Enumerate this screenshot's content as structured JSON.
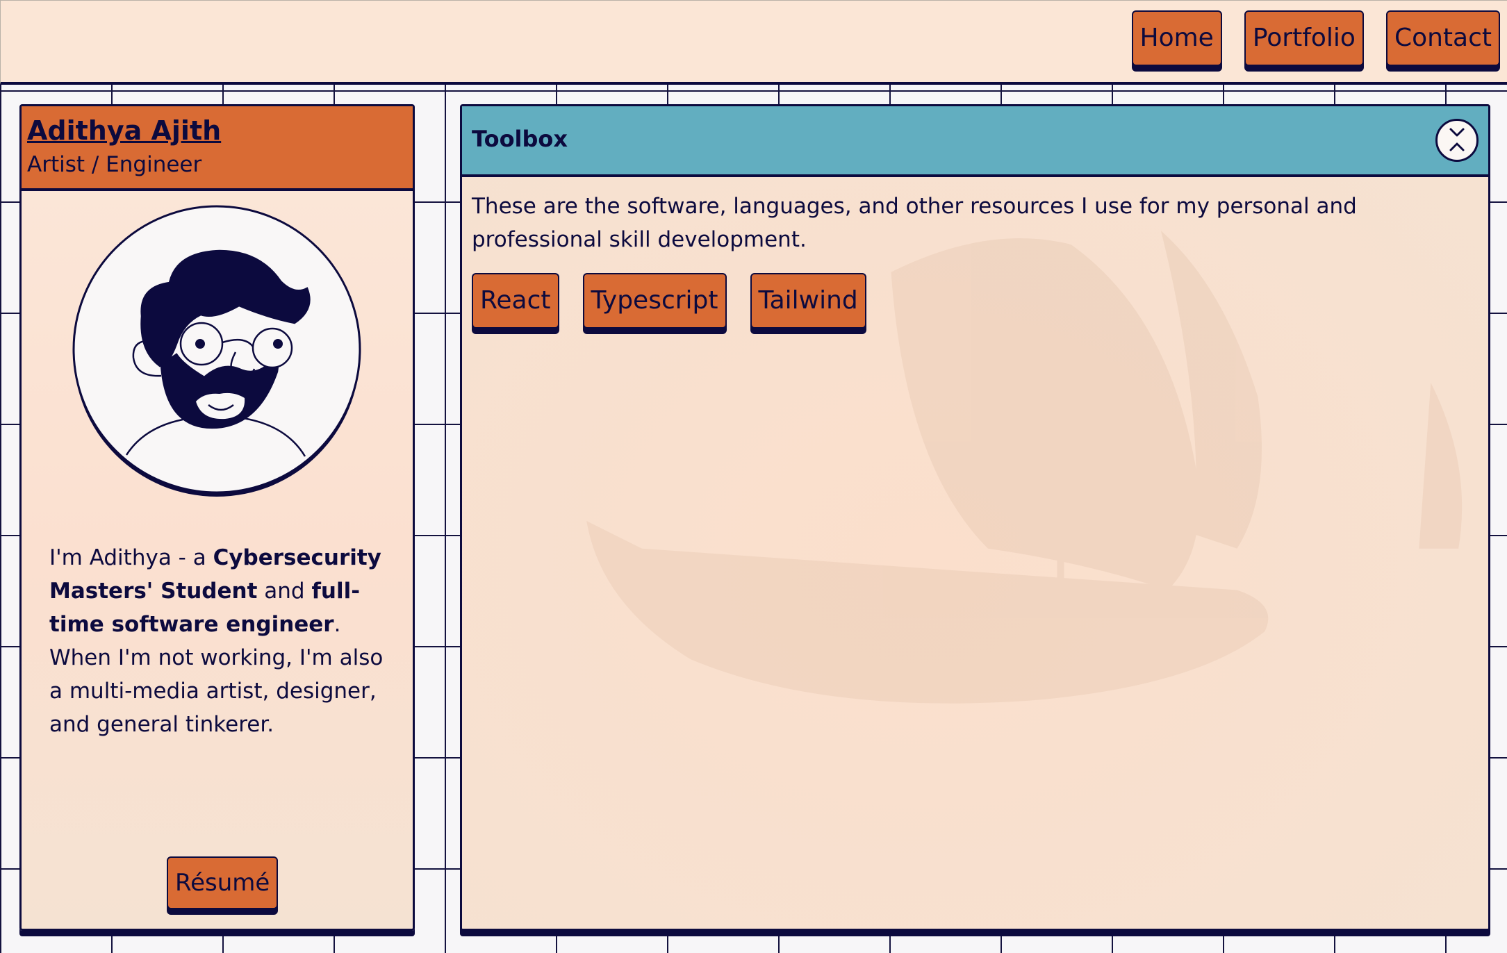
{
  "nav": {
    "items": [
      "Home",
      "Portfolio",
      "Contact"
    ]
  },
  "profile": {
    "name": "Adithya Ajith",
    "role": "Artist / Engineer",
    "bio": {
      "p1": "I'm Adithya - a ",
      "b1": "Cybersecurity Masters' Student",
      "p2": " and ",
      "b2": "full-time software engineer",
      "p3": ". When I'm not working, I'm also a multi-media artist, designer, and general tinkerer."
    },
    "resume_label": "Résumé"
  },
  "toolbox": {
    "title": "Toolbox",
    "description": "These are the software, languages, and other resources I use for my personal and professional skill development.",
    "tags": [
      "React",
      "Typescript",
      "Tailwind"
    ],
    "collapse_icon": "chevrons-collapse-icon"
  },
  "colors": {
    "accent_orange": "#d96b34",
    "accent_teal": "#62aec0",
    "ink": "#0c0a3e",
    "cream": "#fbe6d6"
  }
}
